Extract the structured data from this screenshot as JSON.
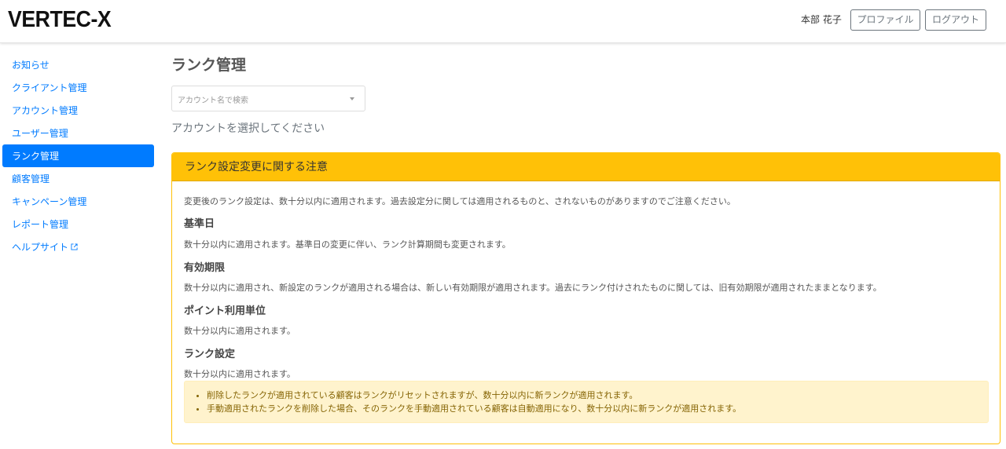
{
  "header": {
    "logo": "VERTEC-X",
    "user_name": "本部 花子",
    "profile_label": "プロファイル",
    "logout_label": "ログアウト"
  },
  "sidebar": {
    "items": [
      {
        "label": "お知らせ"
      },
      {
        "label": "クライアント管理"
      },
      {
        "label": "アカウント管理"
      },
      {
        "label": "ユーザー管理"
      },
      {
        "label": "ランク管理",
        "active": true
      },
      {
        "label": "顧客管理"
      },
      {
        "label": "キャンペーン管理"
      },
      {
        "label": "レポート管理"
      },
      {
        "label": "ヘルプサイト",
        "icon": "external-link-icon"
      }
    ]
  },
  "main": {
    "title": "ランク管理",
    "search_placeholder": "アカウント名で検索",
    "prompt": "アカウントを選択してください"
  },
  "notice": {
    "header": "ランク設定変更に関する注意",
    "intro": "変更後のランク設定は、数十分以内に適用されます。過去設定分に関しては適用されるものと、されないものがありますのでご注意ください。",
    "sections": [
      {
        "title": "基準日",
        "text": "数十分以内に適用されます。基準日の変更に伴い、ランク計算期間も変更されます。"
      },
      {
        "title": "有効期限",
        "text": "数十分以内に適用され、新設定のランクが適用される場合は、新しい有効期限が適用されます。過去にランク付けされたものに関しては、旧有効期限が適用されたままとなります。"
      },
      {
        "title": "ポイント利用単位",
        "text": "数十分以内に適用されます。"
      },
      {
        "title": "ランク設定",
        "text": "数十分以内に適用されます。"
      }
    ],
    "bullets": [
      "削除したランクが適用されている顧客はランクがリセットされますが、数十分以内に新ランクが適用されます。",
      "手動適用されたランクを削除した場合、そのランクを手動適用されている顧客は自動適用になり、数十分以内に新ランクが適用されます。"
    ]
  },
  "colors": {
    "accent": "#007bff",
    "warning": "#ffc107",
    "alert_bg": "#fff3cd"
  }
}
